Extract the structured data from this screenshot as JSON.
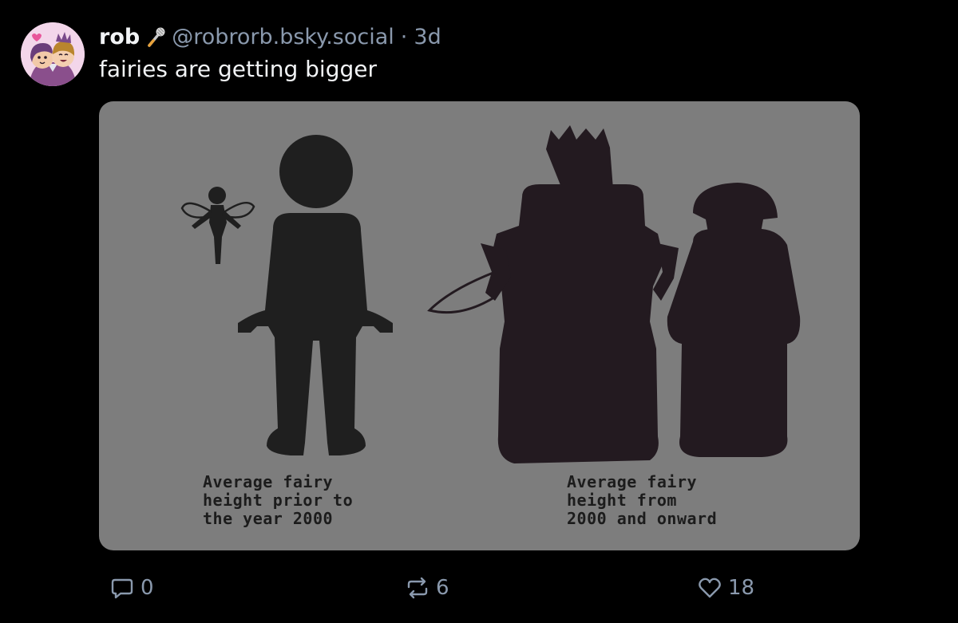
{
  "post": {
    "author": {
      "display_name": "rob",
      "name_emoji": "microphone-emoji",
      "handle": "@robrorb.bsky.social",
      "separator": "·",
      "time_ago": "3d"
    },
    "text": "fairies are getting bigger",
    "image": {
      "caption_left": "Average fairy\nheight prior to\nthe year 2000",
      "caption_right": "Average fairy\nheight from\n2000 and onward"
    },
    "actions": {
      "reply_count": "0",
      "repost_count": "6",
      "like_count": "18"
    }
  },
  "colors": {
    "background": "#000000",
    "text": "#f1f3f5",
    "muted": "#8a99ad",
    "image_bg": "#7d7d7d",
    "silhouette_old": "#1f1f1f",
    "silhouette_new": "#231a20"
  },
  "icons": {
    "reply": "speech-bubble-icon",
    "repost": "repost-arrows-icon",
    "like": "heart-icon"
  }
}
